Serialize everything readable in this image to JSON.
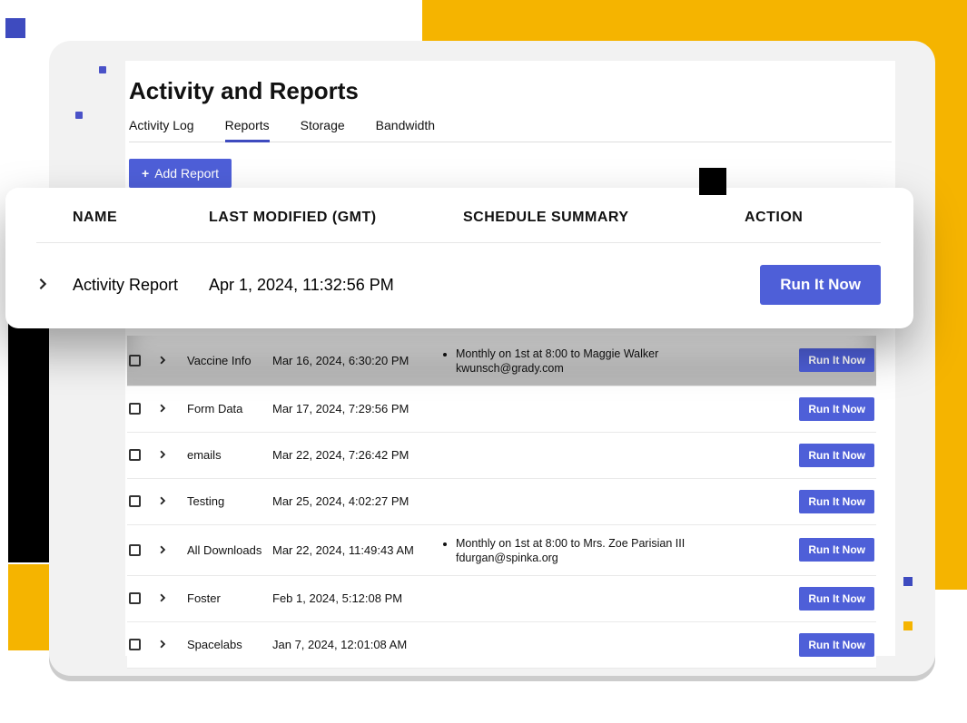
{
  "header": {
    "title": "Activity and Reports",
    "tabs": [
      {
        "label": "Activity Log",
        "active": false
      },
      {
        "label": "Reports",
        "active": true
      },
      {
        "label": "Storage",
        "active": false
      },
      {
        "label": "Bandwidth",
        "active": false
      }
    ],
    "add_button_label": "Add Report"
  },
  "columns": {
    "name": "NAME",
    "modified": "LAST MODIFIED (GMT)",
    "schedule": "SCHEDULE SUMMARY",
    "action": "ACTION"
  },
  "zoom_row": {
    "name": "Activity Report",
    "modified": "Apr 1, 2024, 11:32:56 PM",
    "schedule": "",
    "action_label": "Run It Now"
  },
  "action_label": "Run It Now",
  "rows": [
    {
      "name": "Vaccine Info",
      "modified": "Mar 16, 2024, 6:30:20 PM",
      "schedule": [
        "Monthly on 1st at 8:00 to Maggie Walker",
        "kwunsch@grady.com"
      ],
      "shade": true
    },
    {
      "name": "Form Data",
      "modified": "Mar 17, 2024, 7:29:56 PM",
      "schedule": []
    },
    {
      "name": "emails",
      "modified": "Mar 22, 2024, 7:26:42 PM",
      "schedule": []
    },
    {
      "name": "Testing",
      "modified": "Mar 25, 2024, 4:02:27 PM",
      "schedule": []
    },
    {
      "name": "All Downloads",
      "modified": "Mar 22, 2024, 11:49:43 AM",
      "schedule": [
        "Monthly on 1st at 8:00 to Mrs. Zoe Parisian III",
        "fdurgan@spinka.org"
      ]
    },
    {
      "name": "Foster",
      "modified": "Feb 1, 2024, 5:12:08 PM",
      "schedule": []
    },
    {
      "name": "Spacelabs",
      "modified": "Jan 7, 2024, 12:01:08 AM",
      "schedule": []
    }
  ]
}
